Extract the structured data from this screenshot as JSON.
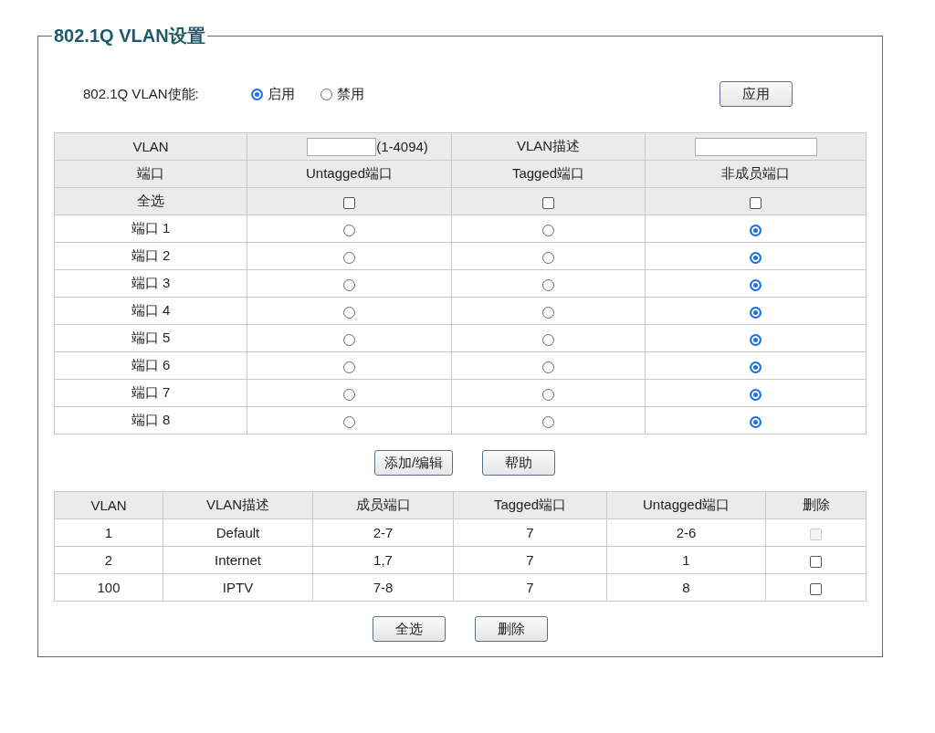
{
  "title": "802.1Q VLAN设置",
  "enable": {
    "label": "802.1Q VLAN使能:",
    "options": [
      {
        "label": "启用",
        "selected": true
      },
      {
        "label": "禁用",
        "selected": false
      }
    ],
    "apply_button": "应用"
  },
  "form": {
    "vlan_label": "VLAN",
    "vlan_range": "(1-4094)",
    "desc_label": "VLAN描述",
    "columns": [
      "端口",
      "Untagged端口",
      "Tagged端口",
      "非成员端口"
    ],
    "select_all_label": "全选",
    "select_all": [
      {
        "checked": false
      },
      {
        "checked": false
      },
      {
        "checked": false
      }
    ],
    "ports": [
      {
        "label": "端口 1",
        "options": [
          {
            "selected": false
          },
          {
            "selected": false
          },
          {
            "selected": true
          }
        ]
      },
      {
        "label": "端口 2",
        "options": [
          {
            "selected": false
          },
          {
            "selected": false
          },
          {
            "selected": true
          }
        ]
      },
      {
        "label": "端口 3",
        "options": [
          {
            "selected": false
          },
          {
            "selected": false
          },
          {
            "selected": true
          }
        ]
      },
      {
        "label": "端口 4",
        "options": [
          {
            "selected": false
          },
          {
            "selected": false
          },
          {
            "selected": true
          }
        ]
      },
      {
        "label": "端口 5",
        "options": [
          {
            "selected": false
          },
          {
            "selected": false
          },
          {
            "selected": true
          }
        ]
      },
      {
        "label": "端口 6",
        "options": [
          {
            "selected": false
          },
          {
            "selected": false
          },
          {
            "selected": true
          }
        ]
      },
      {
        "label": "端口 7",
        "options": [
          {
            "selected": false
          },
          {
            "selected": false
          },
          {
            "selected": true
          }
        ]
      },
      {
        "label": "端口 8",
        "options": [
          {
            "selected": false
          },
          {
            "selected": false
          },
          {
            "selected": true
          }
        ]
      }
    ]
  },
  "form_buttons": [
    "添加/编辑",
    "帮助"
  ],
  "table": {
    "columns": [
      "VLAN",
      "VLAN描述",
      "成员端口",
      "Tagged端口",
      "Untagged端口",
      "删除"
    ],
    "rows": [
      {
        "cells": [
          "1",
          "Default",
          "2-7",
          "7",
          "2-6"
        ],
        "checked": false,
        "disabled": true
      },
      {
        "cells": [
          "2",
          "Internet",
          "1,7",
          "7",
          "1"
        ],
        "checked": false,
        "disabled": false
      },
      {
        "cells": [
          "100",
          "IPTV",
          "7-8",
          "7",
          "8"
        ],
        "checked": false,
        "disabled": false
      }
    ]
  },
  "table_buttons": [
    "全选",
    "删除"
  ]
}
